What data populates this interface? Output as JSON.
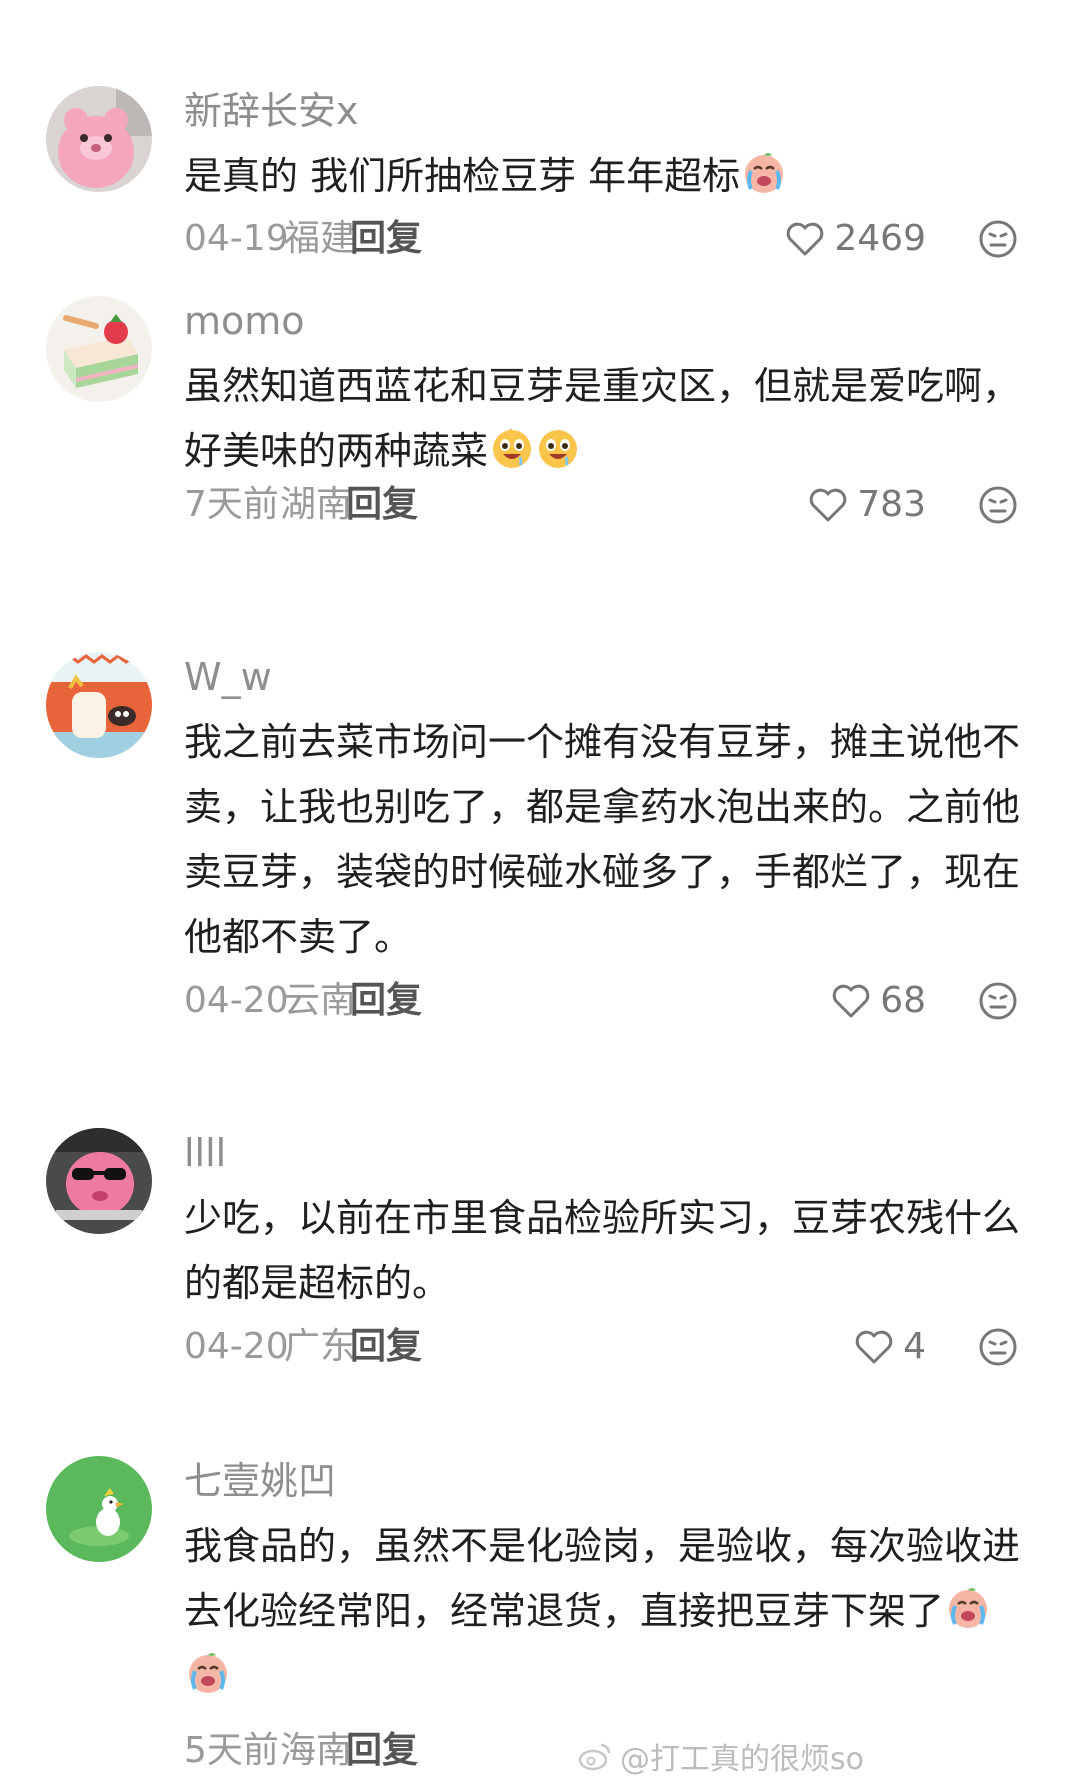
{
  "comments": [
    {
      "username": "新辞长安x",
      "text": "是真的 我们所抽检豆芽 年年超标",
      "emoji": [
        "crying-face-emoji"
      ],
      "date": "04-19",
      "region": "福建",
      "reply_label": "回复",
      "likes": "2469"
    },
    {
      "username": "momo",
      "text": "虽然知道西蓝花和豆芽是重灾区，但就是爱吃啊，好美味的两种蔬菜",
      "emoji": [
        "drooling-face-emoji",
        "drooling-face-emoji"
      ],
      "date": "7天前",
      "region": "湖南",
      "reply_label": "回复",
      "likes": "783"
    },
    {
      "username": "W_w",
      "text": "我之前去菜市场问一个摊有没有豆芽，摊主说他不卖，让我也别吃了，都是拿药水泡出来的。之前他卖豆芽，装袋的时候碰水碰多了，手都烂了，现在他都不卖了。",
      "emoji": [],
      "date": "04-20",
      "region": "云南",
      "reply_label": "回复",
      "likes": "68"
    },
    {
      "username": "llll",
      "text": "少吃，以前在市里食品检验所实习，豆芽农残什么的都是超标的。",
      "emoji": [],
      "date": "04-20",
      "region": "广东",
      "reply_label": "回复",
      "likes": "4"
    },
    {
      "username": "七壹姚凹",
      "text": "我食品的，虽然不是化验岗，是验收，每次验收进去化验经常阳，经常退货，直接把豆芽下架了",
      "emoji": [
        "crying-face-emoji",
        "crying-face-emoji"
      ],
      "date": "5天前",
      "region": "海南",
      "reply_label": "回复",
      "likes": ""
    }
  ],
  "watermark": "@打工真的很烦so",
  "icons": {
    "like": "heart-outline-icon",
    "react": "neutral-face-icon",
    "watermark": "weibo-logo-icon"
  },
  "colors": {
    "username": "#8e8e8e",
    "text": "#1f1f1f",
    "meta": "#9a9a9a",
    "reply": "#555555"
  }
}
